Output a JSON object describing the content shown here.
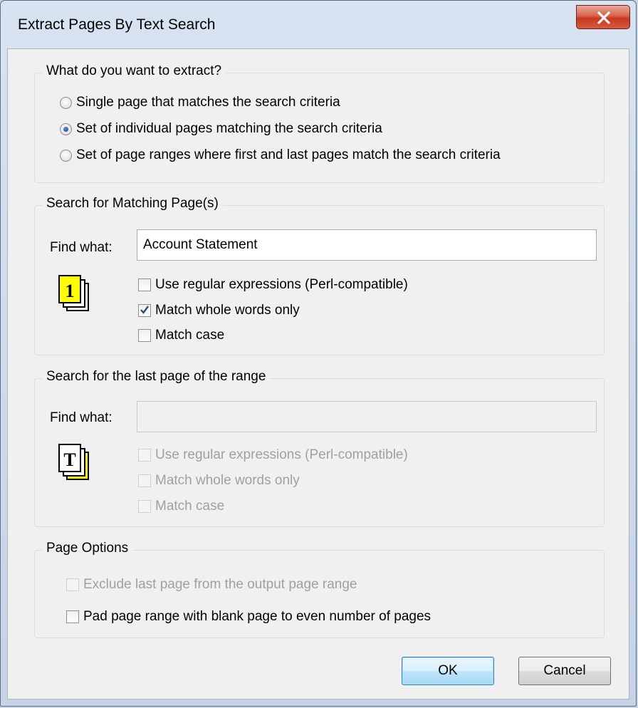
{
  "window": {
    "title": "Extract Pages By Text Search"
  },
  "extract_group": {
    "legend": "What do you want to extract?",
    "options": [
      {
        "label": "Single page that matches the search criteria",
        "selected": false
      },
      {
        "label": "Set of individual pages matching the search criteria",
        "selected": true
      },
      {
        "label": "Set of page ranges where first and last pages match the search criteria",
        "selected": false
      }
    ]
  },
  "match_group": {
    "legend": "Search for Matching Page(s)",
    "find_label": "Find what:",
    "find_value": "Account Statement",
    "icon_glyph": "1",
    "checks": [
      {
        "label": "Use regular expressions (Perl-compatible)",
        "checked": false
      },
      {
        "label": "Match whole words only",
        "checked": true
      },
      {
        "label": "Match case",
        "checked": false
      }
    ]
  },
  "last_group": {
    "legend": "Search for the last page of the range",
    "find_label": "Find what:",
    "find_value": "",
    "icon_glyph": "T",
    "checks": [
      {
        "label": "Use regular expressions (Perl-compatible)",
        "checked": false
      },
      {
        "label": "Match whole words only",
        "checked": false
      },
      {
        "label": "Match case",
        "checked": false
      }
    ]
  },
  "page_options": {
    "legend": "Page Options",
    "exclude_label": "Exclude last page from the output page range",
    "pad_label": "Pad page range with blank page to even number of pages"
  },
  "buttons": {
    "ok": "OK",
    "cancel": "Cancel"
  },
  "colors": {
    "accent": "#3c7fb1",
    "close": "#c4391f",
    "icon_fill": "#ffff00"
  }
}
